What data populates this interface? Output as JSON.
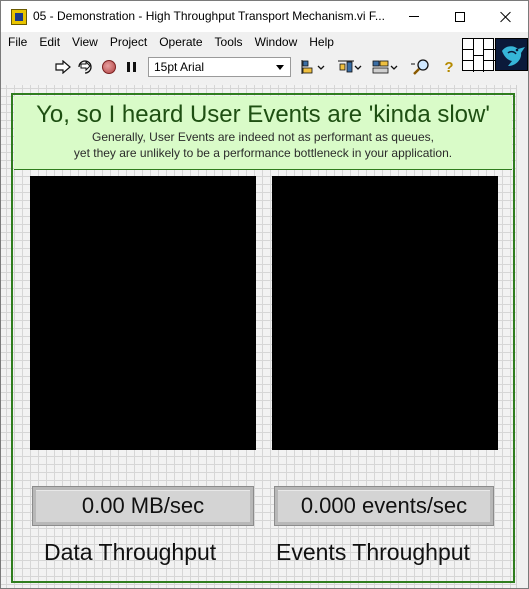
{
  "window": {
    "title": "05 - Demonstration - High Throughput Transport Mechanism.vi F..."
  },
  "menu": {
    "items": [
      "File",
      "Edit",
      "View",
      "Project",
      "Operate",
      "Tools",
      "Window",
      "Help"
    ]
  },
  "toolbar": {
    "font_select_value": "15pt Arial",
    "icons": [
      "run-arrow-icon",
      "run-continuously-icon",
      "abort-icon",
      "pause-icon",
      "align-objects-icon",
      "distribute-objects-icon",
      "resize-objects-icon",
      "search-icon",
      "context-help-icon"
    ]
  },
  "banner": {
    "title": "Yo, so I heard User Events are 'kinda slow'",
    "subtitle_line1": "Generally, User Events are indeed not as performant as queues,",
    "subtitle_line2": "yet they are unlikely to be a performance bottleneck in your application."
  },
  "indicators": {
    "data": {
      "value": "0.00 MB/sec",
      "label": "Data Throughput"
    },
    "events": {
      "value": "0.000 events/sec",
      "label": "Events Throughput"
    }
  },
  "colors": {
    "banner_bg": "#d9fbc8",
    "frame": "#2f7d1e",
    "chart_bg": "#000000"
  }
}
